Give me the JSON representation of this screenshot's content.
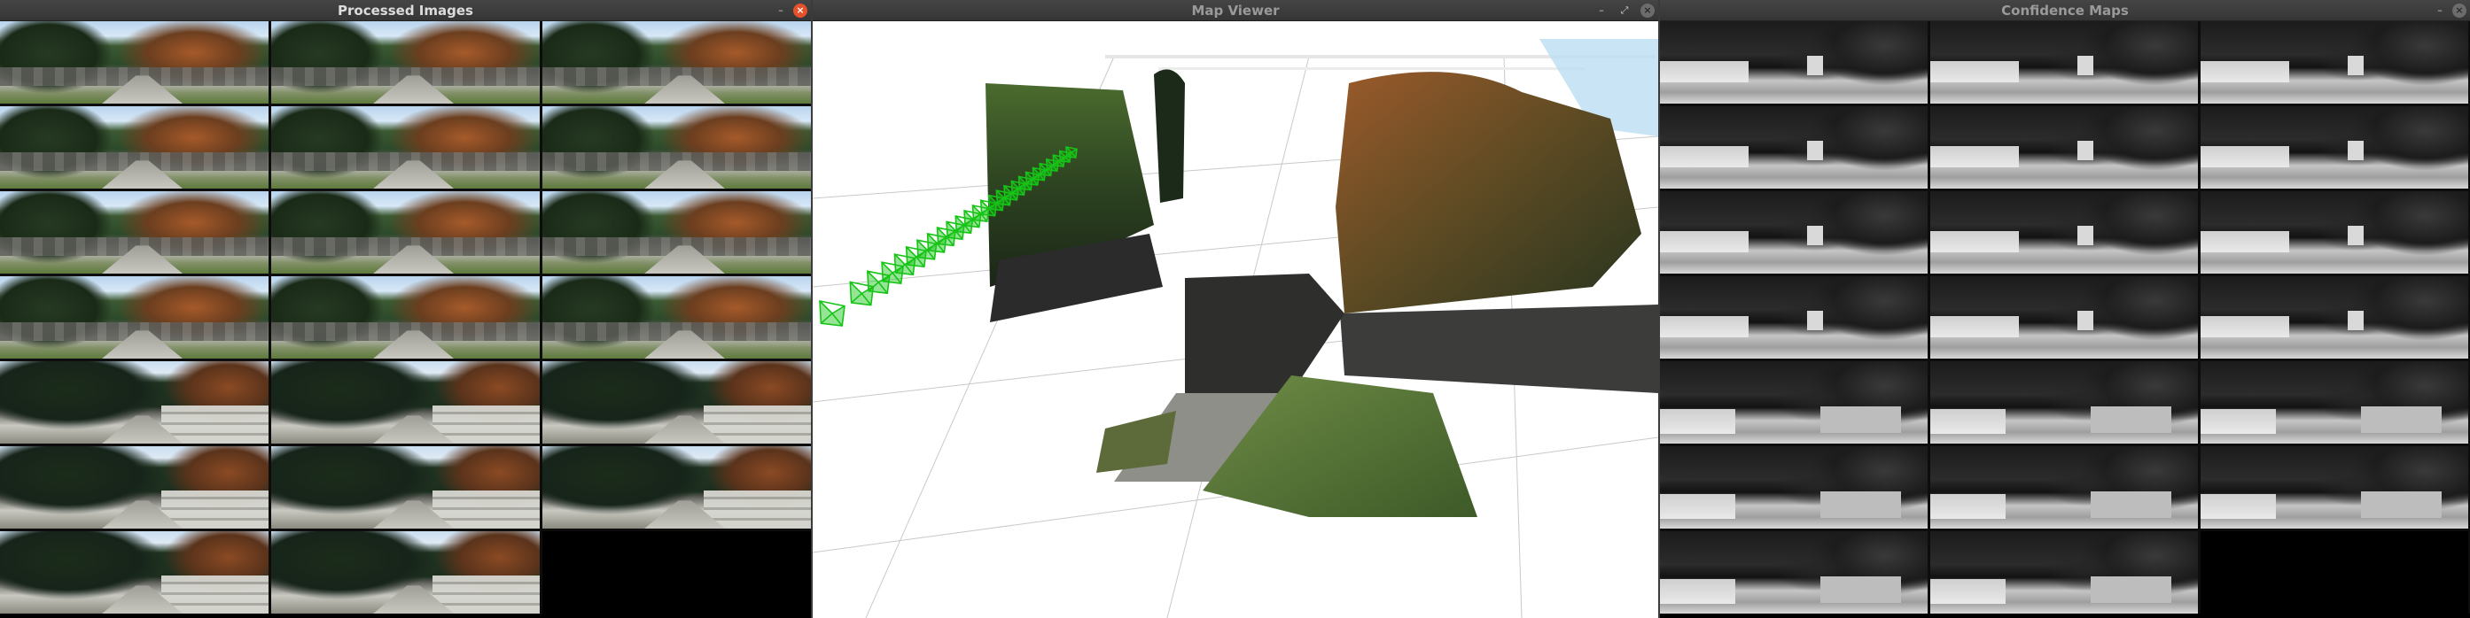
{
  "windows": {
    "processed": {
      "title": "Processed Images",
      "minimize": "–",
      "close": "×"
    },
    "map": {
      "title": "Map Viewer",
      "minimize": "–",
      "maximize": "⤢",
      "close": "×"
    },
    "confidence": {
      "title": "Confidence Maps",
      "minimize": "–",
      "close": "×"
    }
  },
  "colors": {
    "title_active": "#dcdcdc",
    "title_inactive": "#9a9a9a",
    "camera_frustum": "#16c416",
    "close_active": "#e4512b"
  },
  "processed_grid": {
    "rows": 7,
    "cols": 3,
    "filled_tiles": 20,
    "empty_tiles": 1
  },
  "confidence_grid": {
    "rows": 7,
    "cols": 3,
    "filled_tiles": 20,
    "empty_tiles": 1
  },
  "map_viewer": {
    "camera_count": 26,
    "icons": [
      "camera-frustum-icon",
      "point-cloud",
      "ground-grid"
    ]
  }
}
